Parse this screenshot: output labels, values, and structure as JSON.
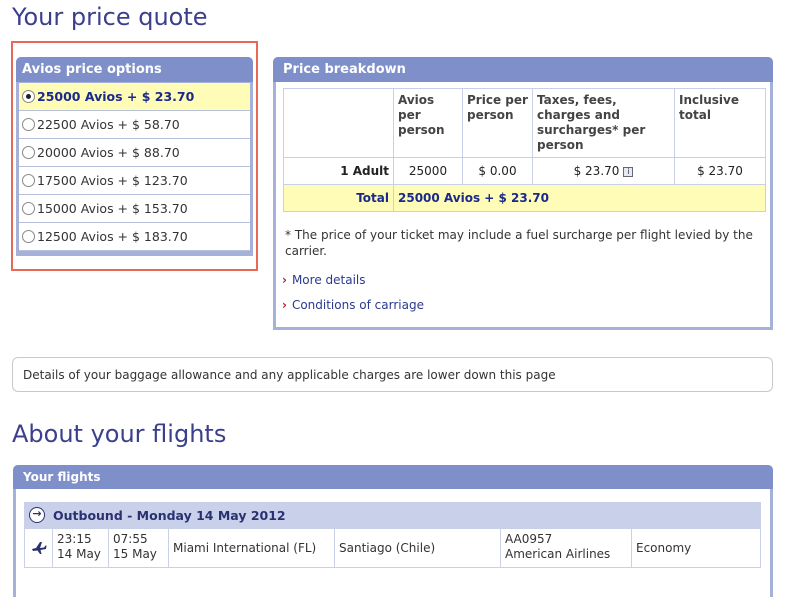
{
  "headings": {
    "price_quote": "Your price quote",
    "about_flights": "About your flights"
  },
  "options": {
    "title": "Avios price options",
    "items": [
      {
        "label": "25000 Avios + $ 23.70",
        "selected": true
      },
      {
        "label": "22500 Avios + $ 58.70",
        "selected": false
      },
      {
        "label": "20000 Avios + $ 88.70",
        "selected": false
      },
      {
        "label": "17500 Avios + $ 123.70",
        "selected": false
      },
      {
        "label": "15000 Avios + $ 153.70",
        "selected": false
      },
      {
        "label": "12500 Avios + $ 183.70",
        "selected": false
      }
    ]
  },
  "breakdown": {
    "title": "Price breakdown",
    "headers": [
      "Avios per person",
      "Price per person",
      "Taxes, fees, charges and surcharges* per person",
      "Inclusive total"
    ],
    "adult_row": {
      "label": "1 Adult",
      "avios": "25000",
      "price": "$ 0.00",
      "taxes": "$ 23.70",
      "total": "$ 23.70"
    },
    "total_row": {
      "label": "Total",
      "value": "25000 Avios + $ 23.70"
    },
    "footnote": "* The price of your ticket may include a fuel surcharge per flight levied by the carrier.",
    "more_details": "More details",
    "conditions": "Conditions of carriage",
    "info_icon_glyph": "i"
  },
  "baggage_note": "Details of your baggage allowance and any applicable charges are lower down this page",
  "flights": {
    "title": "Your flights",
    "outbound_label": "Outbound - Monday 14 May 2012",
    "row": {
      "depart_time": "23:15",
      "depart_date": "14 May",
      "arrive_time": "07:55",
      "arrive_date": "15 May",
      "origin": "Miami International (FL)",
      "destination": "Santiago (Chile)",
      "flight_no": "AA0957",
      "airline": "American Airlines",
      "cabin": "Economy"
    }
  },
  "colors": {
    "heading": "#3b3f8c",
    "panel_header": "#7f8fc9",
    "highlight_border": "#e8685a",
    "selected_bg": "#fffcb8"
  }
}
